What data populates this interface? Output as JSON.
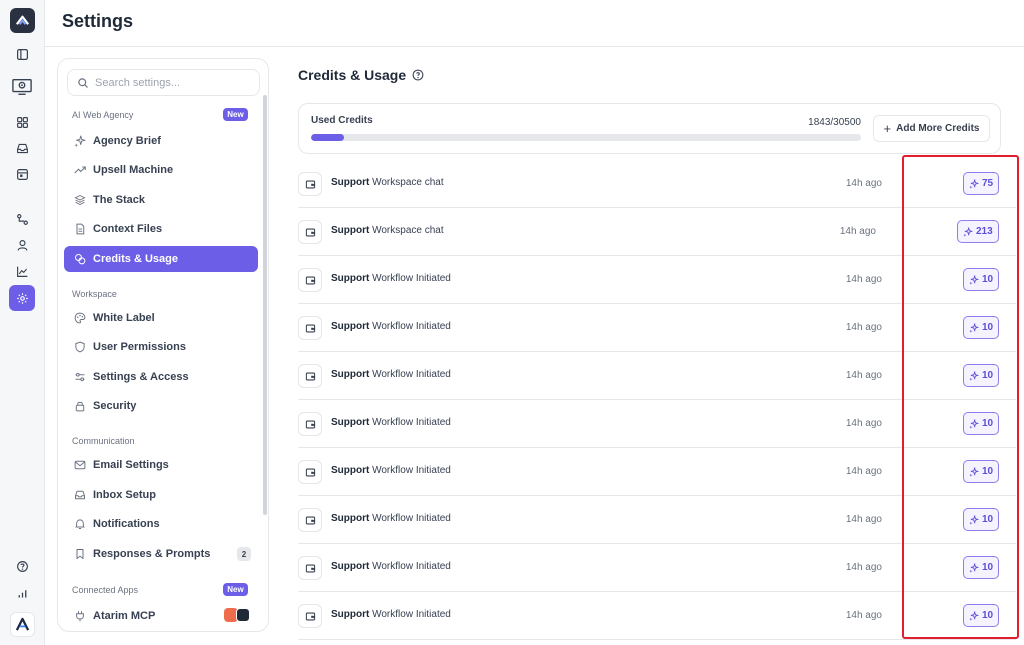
{
  "header": {
    "title": "Settings"
  },
  "search": {
    "placeholder": "Search settings..."
  },
  "sections": {
    "ai_web_agency": {
      "label": "AI Web Agency",
      "badge": "New"
    },
    "workspace": {
      "label": "Workspace"
    },
    "communication": {
      "label": "Communication"
    },
    "connected_apps": {
      "label": "Connected Apps",
      "badge": "New"
    }
  },
  "nav": {
    "agency_brief": "Agency Brief",
    "upsell_machine": "Upsell Machine",
    "the_stack": "The Stack",
    "context_files": "Context Files",
    "credits_usage": "Credits & Usage",
    "white_label": "White Label",
    "user_permissions": "User Permissions",
    "settings_access": "Settings & Access",
    "security": "Security",
    "email_settings": "Email Settings",
    "inbox_setup": "Inbox Setup",
    "notifications": "Notifications",
    "responses_prompts": "Responses & Prompts",
    "responses_prompts_count": "2",
    "atarim_mcp": "Atarim MCP"
  },
  "main": {
    "title": "Credits & Usage",
    "credits": {
      "label": "Used Credits",
      "used": 1843,
      "total": 30500,
      "display": "1843/30500",
      "add_button": "Add More Credits"
    },
    "rows": [
      {
        "source": "Support",
        "action": "Workspace chat",
        "time": "14h ago",
        "credits": "75"
      },
      {
        "source": "Support",
        "action": "Workspace chat",
        "time": "14h ago",
        "credits": "213"
      },
      {
        "source": "Support",
        "action": "Workflow Initiated",
        "time": "14h ago",
        "credits": "10"
      },
      {
        "source": "Support",
        "action": "Workflow Initiated",
        "time": "14h ago",
        "credits": "10"
      },
      {
        "source": "Support",
        "action": "Workflow Initiated",
        "time": "14h ago",
        "credits": "10"
      },
      {
        "source": "Support",
        "action": "Workflow Initiated",
        "time": "14h ago",
        "credits": "10"
      },
      {
        "source": "Support",
        "action": "Workflow Initiated",
        "time": "14h ago",
        "credits": "10"
      },
      {
        "source": "Support",
        "action": "Workflow Initiated",
        "time": "14h ago",
        "credits": "10"
      },
      {
        "source": "Support",
        "action": "Workflow Initiated",
        "time": "14h ago",
        "credits": "10"
      },
      {
        "source": "Support",
        "action": "Workflow Initiated",
        "time": "14h ago",
        "credits": "10"
      }
    ]
  },
  "colors": {
    "accent": "#6d5ee8",
    "highlight": "#e11d2e"
  },
  "icons": {
    "rail": [
      "logo-icon",
      "panel-icon",
      "computer-gear-icon",
      "grid-icon",
      "inbox-icon",
      "calendar-icon",
      "workflow-icon",
      "user-icon",
      "chart-line-icon",
      "settings-icon",
      "help-icon",
      "bar-chart-icon",
      "brand-logo-icon"
    ],
    "row": "wallet-icon",
    "credit": "sparkle-icon"
  }
}
